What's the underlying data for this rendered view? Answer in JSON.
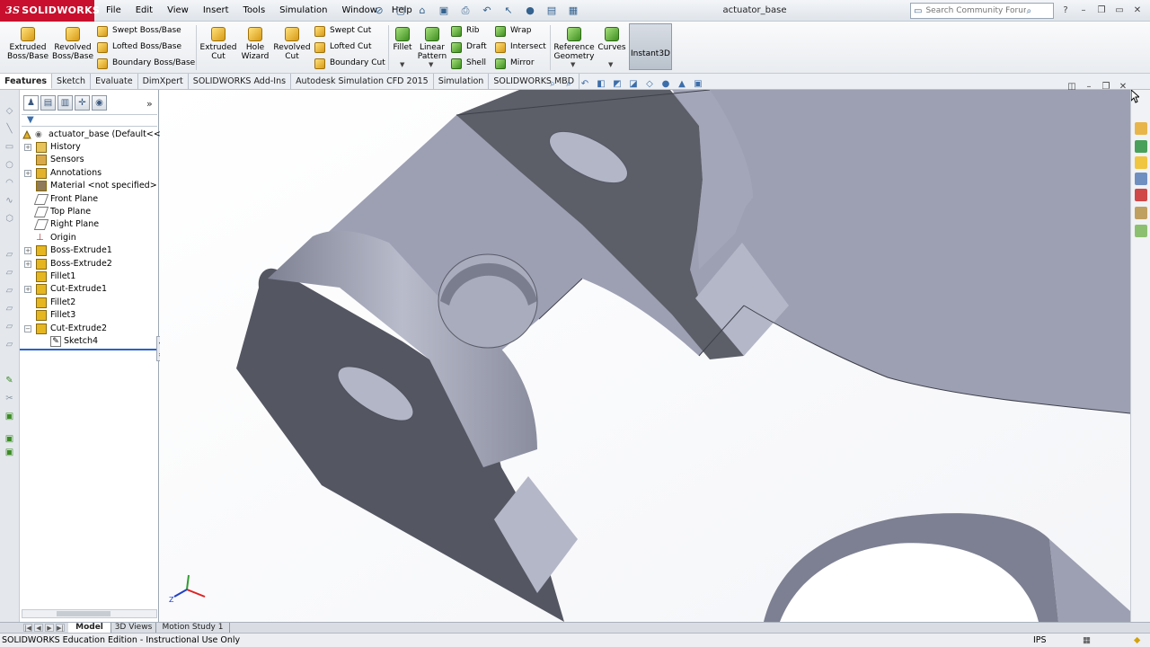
{
  "app": {
    "brand": "SOLIDWORKS",
    "brand_prefix": "3S",
    "document_title": "actuator_base"
  },
  "menu": [
    "File",
    "Edit",
    "View",
    "Insert",
    "Tools",
    "Simulation",
    "Window",
    "Help"
  ],
  "search": {
    "placeholder": "Search Community Forum"
  },
  "ribbon": {
    "extruded_boss": "Extruded Boss/Base",
    "revolved_boss": "Revolved Boss/Base",
    "swept_boss": "Swept Boss/Base",
    "lofted_boss": "Lofted Boss/Base",
    "boundary_boss": "Boundary Boss/Base",
    "extruded_cut": "Extruded Cut",
    "hole_wizard": "Hole Wizard",
    "revolved_cut": "Revolved Cut",
    "swept_cut": "Swept Cut",
    "lofted_cut": "Lofted Cut",
    "boundary_cut": "Boundary Cut",
    "fillet": "Fillet",
    "linear_pattern": "Linear Pattern",
    "rib": "Rib",
    "draft": "Draft",
    "shell": "Shell",
    "wrap": "Wrap",
    "intersect": "Intersect",
    "mirror": "Mirror",
    "reference_geometry": "Reference Geometry",
    "curves": "Curves",
    "instant3d": "Instant3D"
  },
  "cm_tabs": [
    "Features",
    "Sketch",
    "Evaluate",
    "DimXpert",
    "SOLIDWORKS Add-Ins",
    "Autodesk Simulation CFD 2015",
    "Simulation",
    "SOLIDWORKS MBD"
  ],
  "tree": {
    "root": "actuator_base  (Default<<De",
    "items": [
      "History",
      "Sensors",
      "Annotations",
      "Material <not specified>",
      "Front Plane",
      "Top Plane",
      "Right Plane",
      "Origin",
      "Boss-Extrude1",
      "Boss-Extrude2",
      "Fillet1",
      "Cut-Extrude1",
      "Fillet2",
      "Fillet3",
      "Cut-Extrude2"
    ],
    "child": "Sketch4"
  },
  "bottom_tabs": [
    "Model",
    "3D Views",
    "Motion Study 1"
  ],
  "status": {
    "text": "SOLIDWORKS Education Edition - Instructional Use Only",
    "units": "IPS"
  },
  "colors": {
    "brand": "#c8102e",
    "model_face": "#9da0b3",
    "model_dark": "#54565f",
    "selection": "#2a62c9"
  }
}
